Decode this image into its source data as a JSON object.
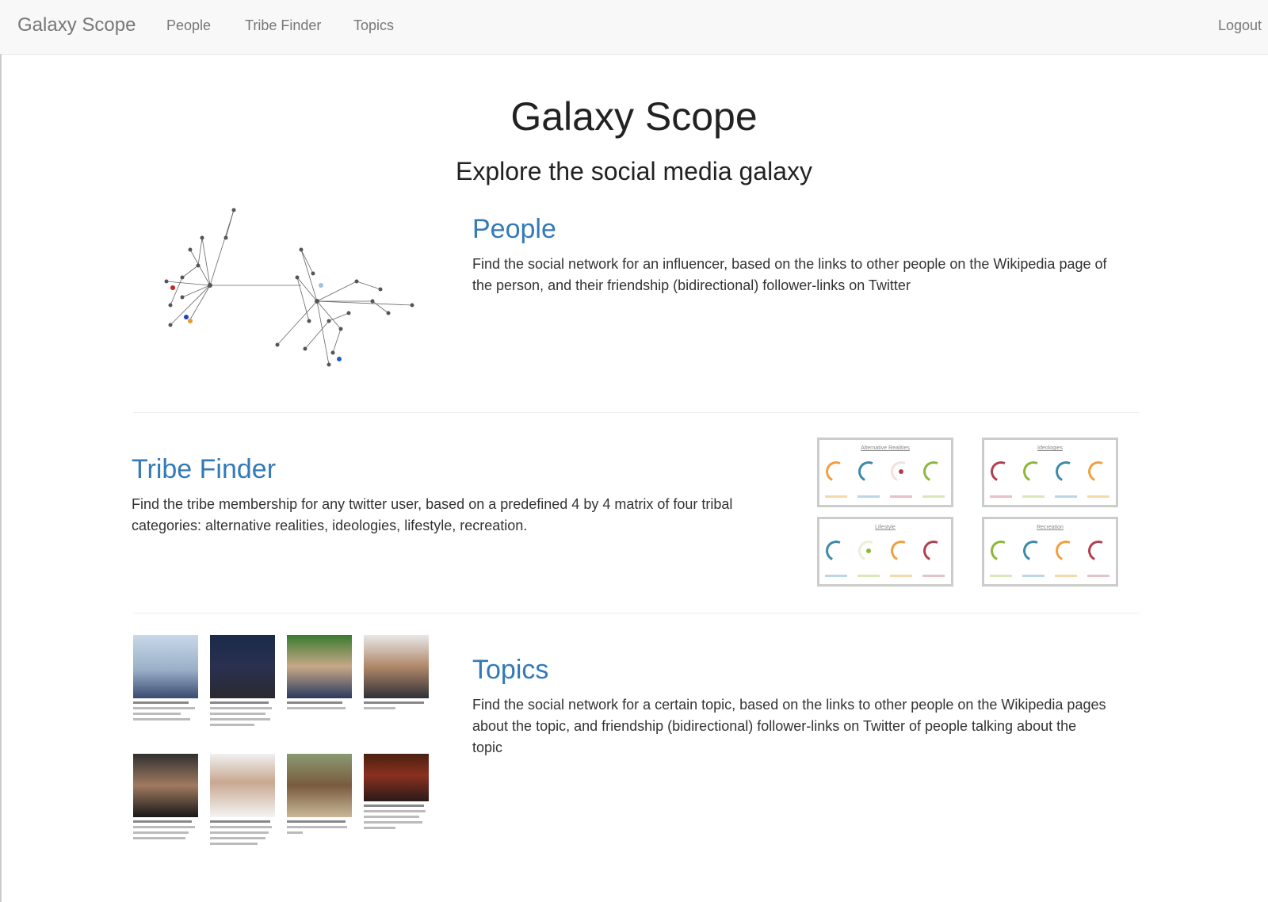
{
  "navbar": {
    "brand": "Galaxy Scope",
    "links": [
      "People",
      "Tribe Finder",
      "Topics"
    ],
    "logout": "Logout"
  },
  "header": {
    "title": "Galaxy Scope",
    "subtitle": "Explore the social media galaxy"
  },
  "sections": {
    "people": {
      "title": "People",
      "description": "Find the social network for an influencer, based on the links to other people on the Wikipedia page of the person, and their friendship (bidirectional) follower-links on Twitter"
    },
    "tribe_finder": {
      "title": "Tribe Finder",
      "description": "Find the tribe membership for any twitter user, based on a predefined 4 by 4 matrix of four tribal categories: alternative realities, ideologies, lifestyle, recreation.",
      "panels": [
        "Alternative Realities",
        "Ideologies",
        "Lifestyle",
        "Recreation"
      ]
    },
    "topics": {
      "title": "Topics",
      "description": "Find the social network for a certain topic, based on the links to other people on the Wikipedia pages about the topic, and friendship (bidirectional) follower-links on Twitter of people talking about the topic"
    }
  },
  "colors": {
    "link": "#337ab7",
    "orange": "#f0a040",
    "teal": "#3a8aa8",
    "red": "#b04050",
    "green": "#8ab83a"
  }
}
